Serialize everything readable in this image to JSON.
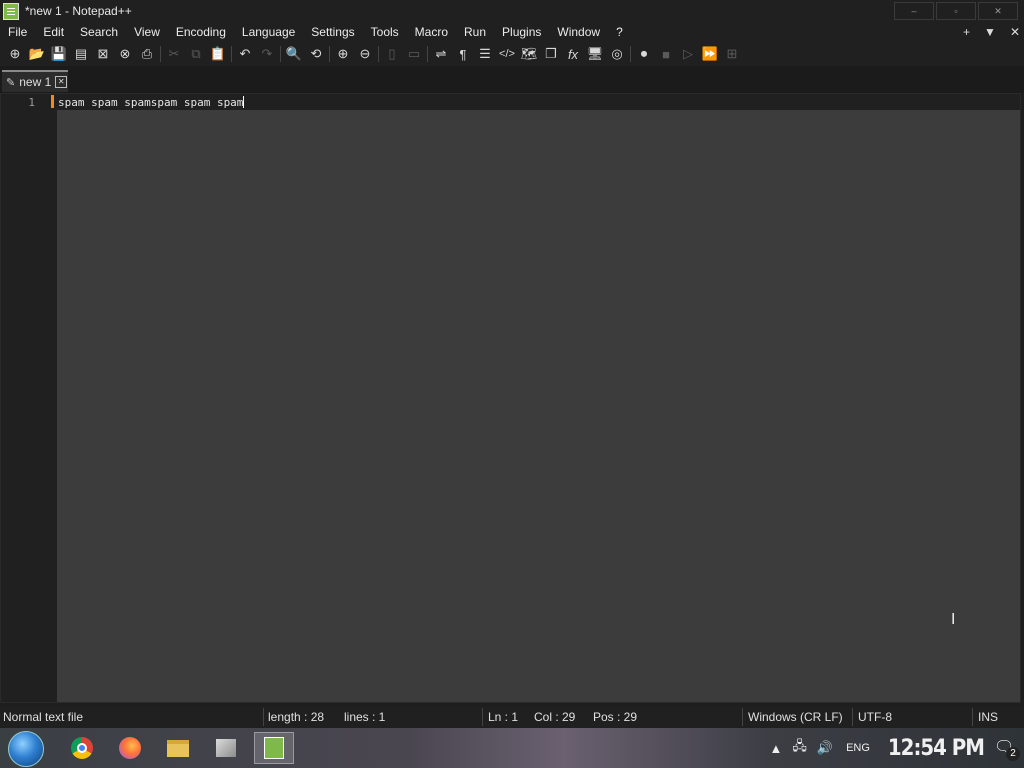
{
  "window": {
    "title": "*new 1 - Notepad++",
    "controls": [
      {
        "name": "minimize",
        "glyph": "–"
      },
      {
        "name": "maximize",
        "glyph": "▫"
      },
      {
        "name": "close",
        "glyph": "✕"
      }
    ]
  },
  "menu": {
    "items": [
      "File",
      "Edit",
      "Search",
      "View",
      "Encoding",
      "Language",
      "Settings",
      "Tools",
      "Macro",
      "Run",
      "Plugins",
      "Window",
      "?"
    ],
    "right": {
      "add": "+",
      "dropdown": "▼",
      "close": "✕"
    }
  },
  "toolbar": {
    "buttons": [
      {
        "icon": "new-file-icon",
        "glyph": "⊕",
        "enabled": true
      },
      {
        "icon": "open-file-icon",
        "glyph": "📂",
        "enabled": true
      },
      {
        "icon": "save-icon",
        "glyph": "💾",
        "enabled": true
      },
      {
        "icon": "save-all-icon",
        "glyph": "▤",
        "enabled": true
      },
      {
        "icon": "close-icon",
        "glyph": "⊠",
        "enabled": true
      },
      {
        "icon": "close-all-icon",
        "glyph": "⊗",
        "enabled": true
      },
      {
        "icon": "print-icon",
        "glyph": "⎙",
        "enabled": true
      },
      {
        "icon": "cut-icon",
        "glyph": "✂",
        "enabled": false
      },
      {
        "icon": "copy-icon",
        "glyph": "⧉",
        "enabled": false
      },
      {
        "icon": "paste-icon",
        "glyph": "📋",
        "enabled": false
      },
      {
        "icon": "undo-icon",
        "glyph": "↶",
        "enabled": true
      },
      {
        "icon": "redo-icon",
        "glyph": "↷",
        "enabled": false
      },
      {
        "icon": "find-icon",
        "glyph": "🔍",
        "enabled": true
      },
      {
        "icon": "replace-icon",
        "glyph": "⟲",
        "enabled": true
      },
      {
        "icon": "zoom-in-icon",
        "glyph": "⊕",
        "enabled": true
      },
      {
        "icon": "zoom-out-icon",
        "glyph": "⊖",
        "enabled": true
      },
      {
        "icon": "sync-vertical-icon",
        "glyph": "▯",
        "enabled": false
      },
      {
        "icon": "sync-horizontal-icon",
        "glyph": "▭",
        "enabled": false
      },
      {
        "icon": "word-wrap-icon",
        "glyph": "⇌",
        "enabled": true
      },
      {
        "icon": "show-all-chars-icon",
        "glyph": "¶",
        "enabled": true
      },
      {
        "icon": "indent-guide-icon",
        "glyph": "☰",
        "enabled": true
      },
      {
        "icon": "xml-tag-icon",
        "glyph": "</>",
        "enabled": true
      },
      {
        "icon": "document-map-icon",
        "glyph": "🗺",
        "enabled": true
      },
      {
        "icon": "document-list-icon",
        "glyph": "❐",
        "enabled": true
      },
      {
        "icon": "function-list-icon",
        "glyph": "fx",
        "enabled": true
      },
      {
        "icon": "folder-workspace-icon",
        "glyph": "🖥",
        "enabled": true
      },
      {
        "icon": "monitoring-icon",
        "glyph": "◎",
        "enabled": true
      },
      {
        "icon": "record-macro-icon",
        "glyph": "⏺",
        "enabled": true
      },
      {
        "icon": "stop-macro-icon",
        "glyph": "■",
        "enabled": false
      },
      {
        "icon": "play-macro-icon",
        "glyph": "▷",
        "enabled": false
      },
      {
        "icon": "run-macro-multiple-icon",
        "glyph": "⏩",
        "enabled": true
      },
      {
        "icon": "save-macro-icon",
        "glyph": "⊞",
        "enabled": false
      }
    ]
  },
  "tabs": [
    {
      "label": "new 1",
      "close": "✕"
    }
  ],
  "editor": {
    "line_number": "1",
    "line_text": "spam spam spamspam spam spam"
  },
  "status": {
    "file_type": "Normal text file",
    "length": "length : 28",
    "lines": "lines : 1",
    "ln": "Ln : 1",
    "col": "Col : 29",
    "pos": "Pos : 29",
    "eol": "Windows (CR LF)",
    "encoding": "UTF-8",
    "mode": "INS"
  },
  "taskbar": {
    "lang": "ENG",
    "time": "12:54 PM",
    "notification_count": "2"
  }
}
